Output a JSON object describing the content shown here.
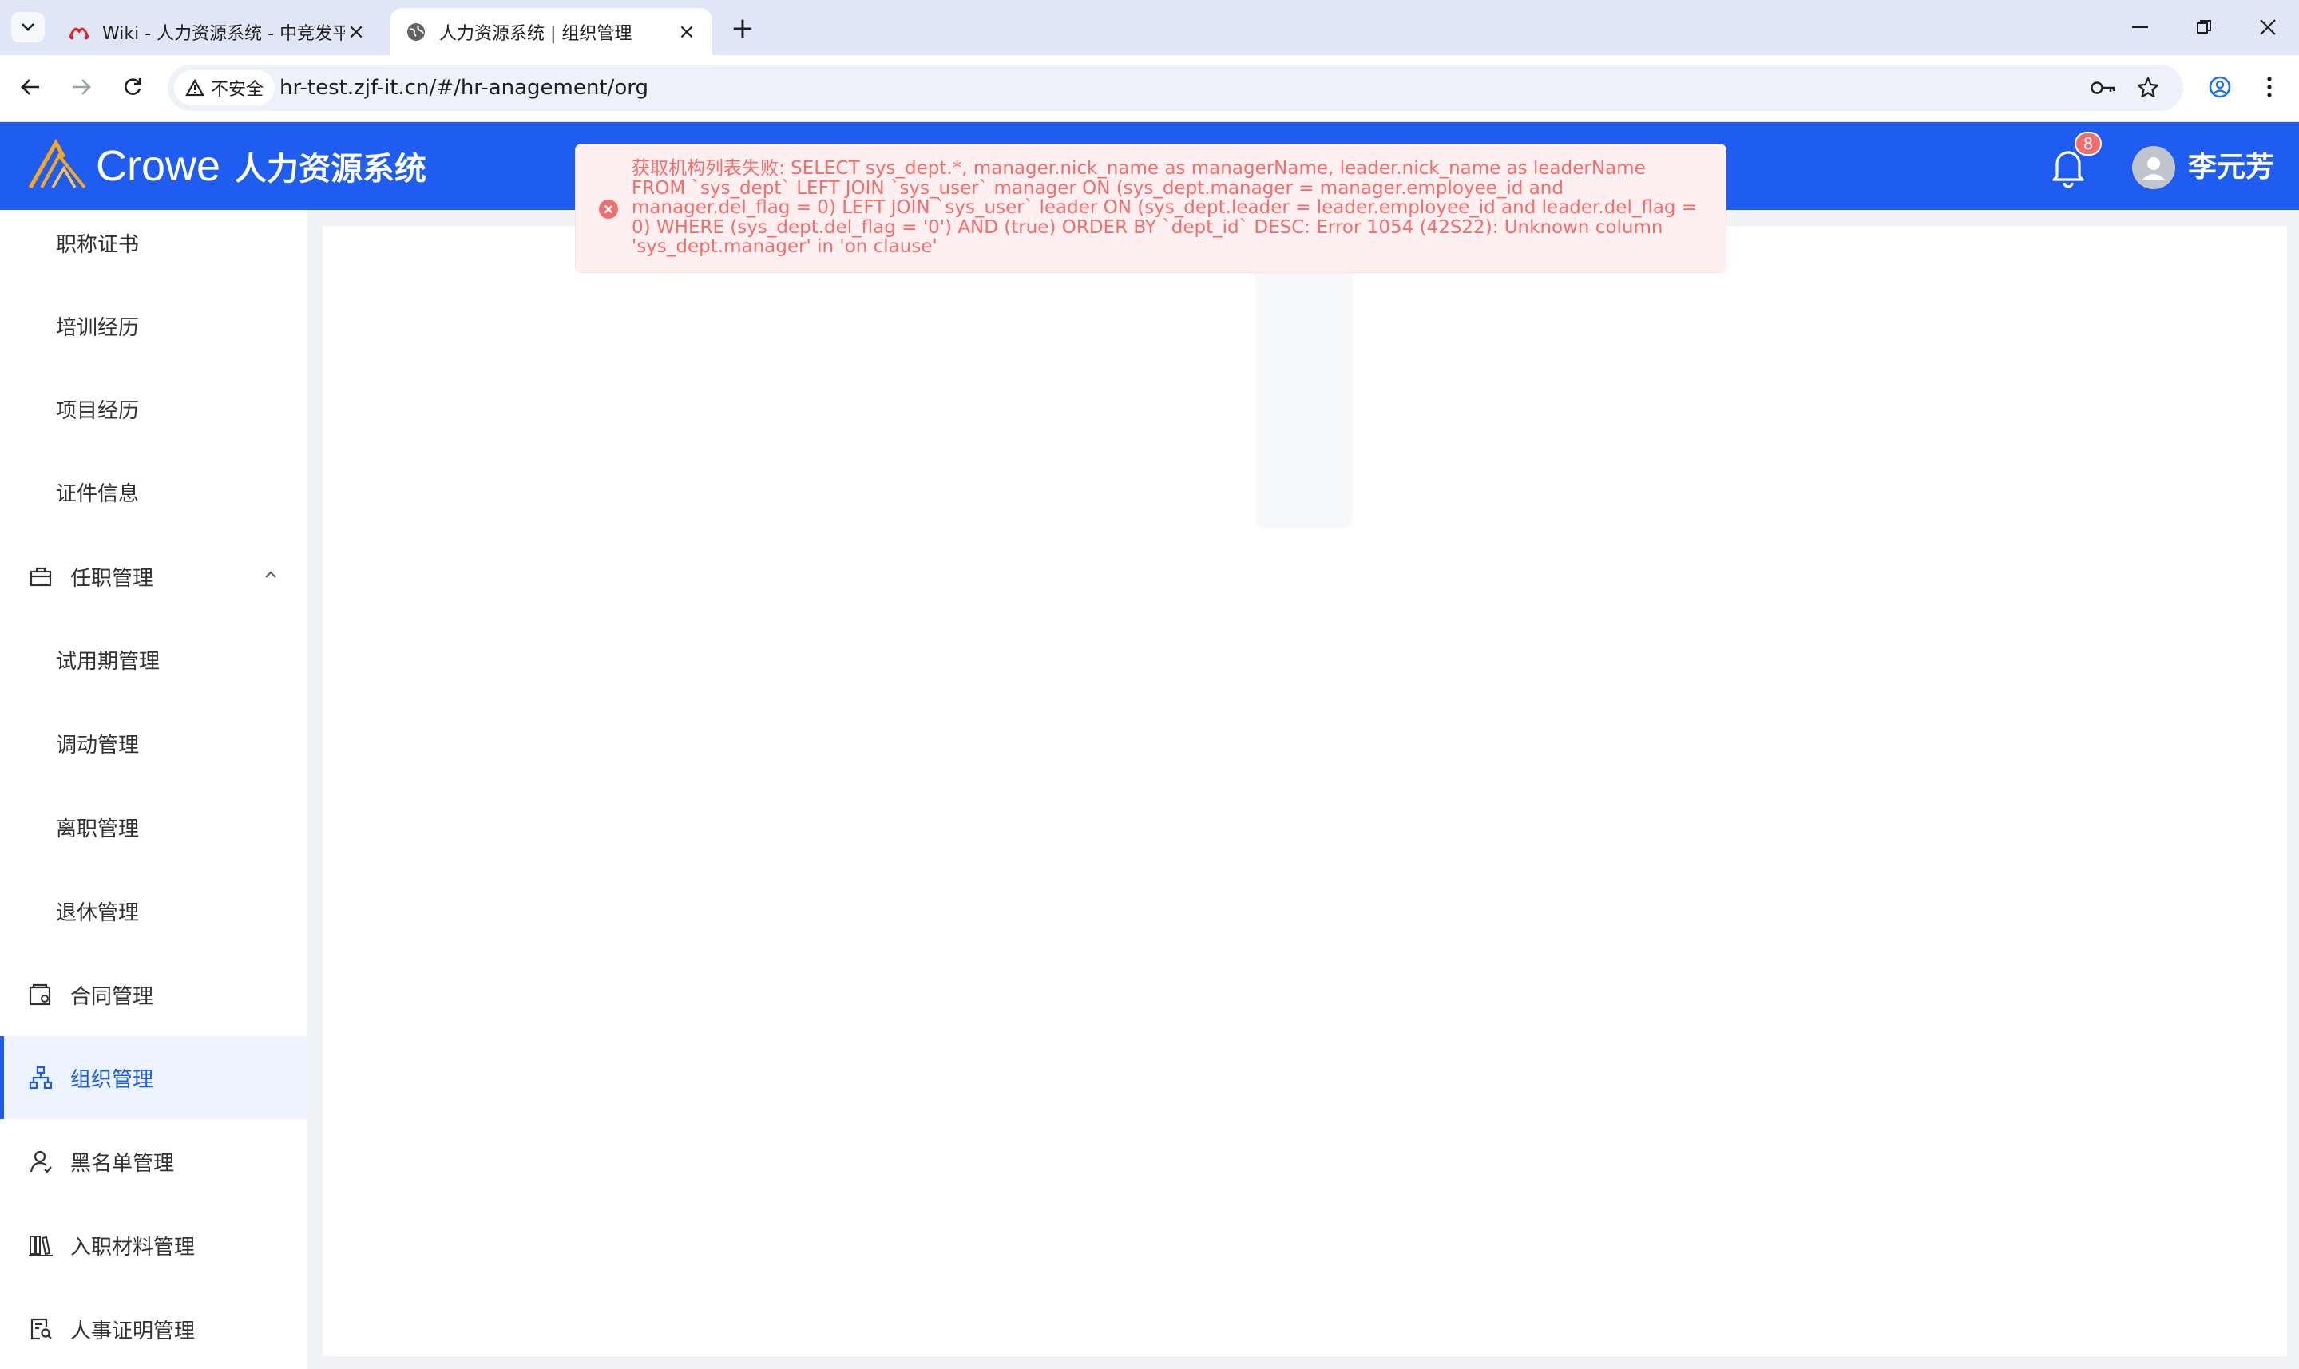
{
  "browser": {
    "tabs": [
      {
        "title": "Wiki - 人力资源系统 - 中竞发平",
        "active": false
      },
      {
        "title": "人力资源系统 | 组织管理",
        "active": true
      }
    ],
    "new_tab_label": "+",
    "security_chip": "不安全",
    "url": "hr-test.zjf-it.cn/#/hr-anagement/org"
  },
  "header": {
    "brand": "Crowe",
    "system_name": "人力资源系统",
    "notification_count": "8",
    "username": "李元芳",
    "accent_color": "#1f5cf0"
  },
  "sidebar": {
    "items": [
      {
        "label": "职称证书",
        "level": "sub",
        "icon": ""
      },
      {
        "label": "培训经历",
        "level": "sub",
        "icon": ""
      },
      {
        "label": "项目经历",
        "level": "sub",
        "icon": ""
      },
      {
        "label": "证件信息",
        "level": "sub",
        "icon": ""
      },
      {
        "label": "任职管理",
        "level": "top",
        "icon": "briefcase-icon",
        "expanded": true
      },
      {
        "label": "试用期管理",
        "level": "sub",
        "icon": ""
      },
      {
        "label": "调动管理",
        "level": "sub",
        "icon": ""
      },
      {
        "label": "离职管理",
        "level": "sub",
        "icon": ""
      },
      {
        "label": "退休管理",
        "level": "sub",
        "icon": ""
      },
      {
        "label": "合同管理",
        "level": "top",
        "icon": "contract-icon"
      },
      {
        "label": "组织管理",
        "level": "top",
        "icon": "org-chart-icon",
        "active": true
      },
      {
        "label": "黑名单管理",
        "level": "top",
        "icon": "user-icon"
      },
      {
        "label": "入职材料管理",
        "level": "top",
        "icon": "books-icon"
      },
      {
        "label": "人事证明管理",
        "level": "top",
        "icon": "document-search-icon"
      }
    ]
  },
  "error": {
    "message": "获取机构列表失败: SELECT sys_dept.*, manager.nick_name as managerName, leader.nick_name as leaderName FROM `sys_dept` LEFT JOIN `sys_user` manager ON (sys_dept.manager = manager.employee_id and manager.del_flag = 0) LEFT JOIN `sys_user` leader ON (sys_dept.leader = leader.employee_id and leader.del_flag = 0) WHERE (sys_dept.del_flag = '0') AND (true) ORDER BY `dept_id` DESC: Error 1054 (42S22): Unknown column 'sys_dept.manager' in 'on clause'",
    "color": "#f56c6c"
  }
}
